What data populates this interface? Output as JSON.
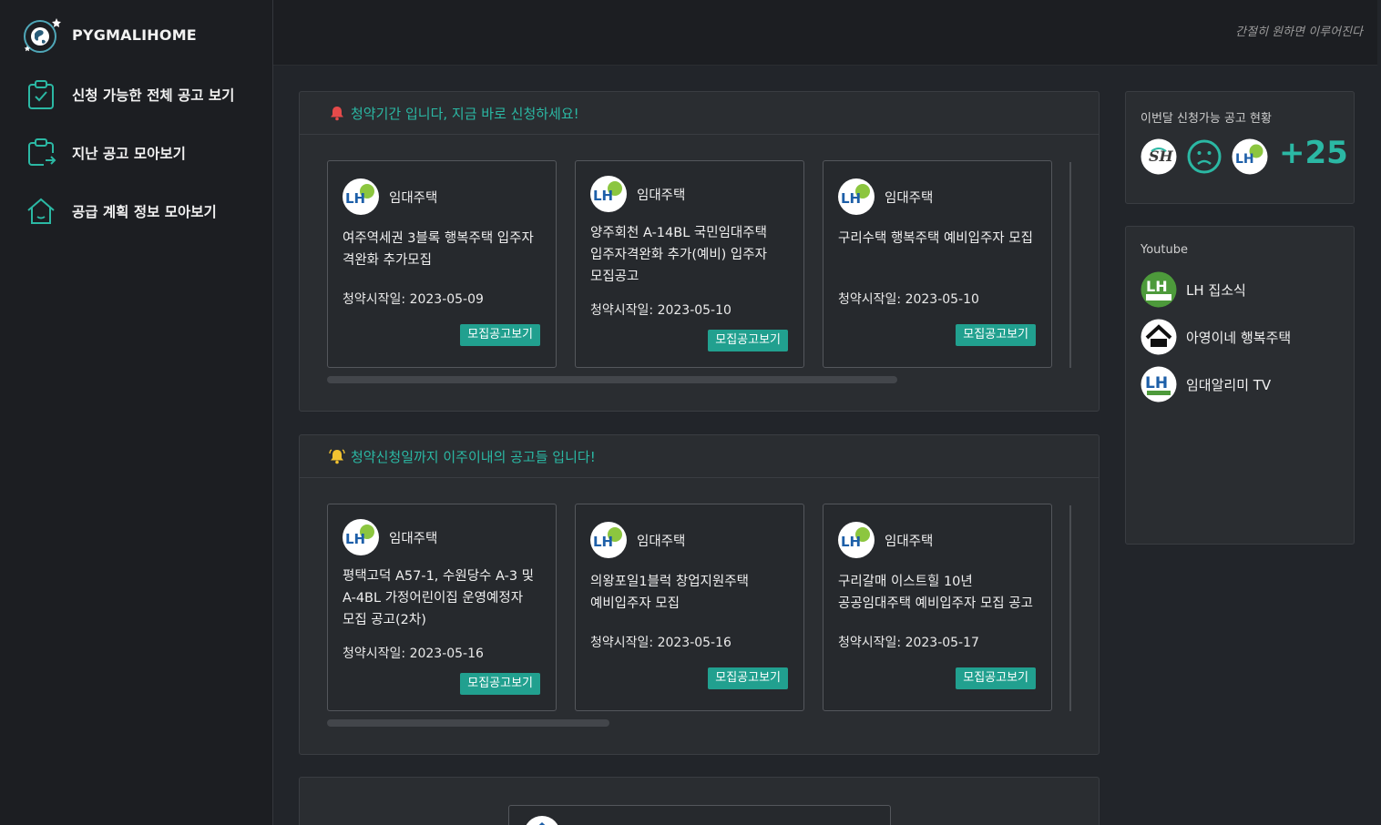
{
  "brand": {
    "name": "PYGMALIHOME",
    "logo_icon": "globe-star-logo"
  },
  "sidebar": {
    "items": [
      {
        "label": "신청 가능한 전체 공고 보기",
        "icon": "clipboard-check-icon"
      },
      {
        "label": "지난 공고 모아보기",
        "icon": "clipboard-share-icon"
      },
      {
        "label": "공급 계획 정보 모아보기",
        "icon": "house-icon"
      }
    ]
  },
  "topbar": {
    "tagline": "간절히 원하면 이루어진다"
  },
  "sections": [
    {
      "heading": "청약기간 입니다, 지금 바로 신청하세요!",
      "icon": "bell-red-icon",
      "cards": [
        {
          "type": "임대주택",
          "title": "여주역세권 3블록 행복주택 입주자 격완화 추가모집",
          "date": "청약시작일: 2023-05-09",
          "button": "모집공고보기"
        },
        {
          "type": "임대주택",
          "title": "양주회천 A-14BL 국민임대주택 입주자격완화 추가(예비) 입주자 모집공고",
          "date": "청약시작일: 2023-05-10",
          "button": "모집공고보기"
        },
        {
          "type": "임대주택",
          "title": "구리수택 행복주택 예비입주자 모집",
          "date": "청약시작일: 2023-05-10",
          "button": "모집공고보기"
        }
      ]
    },
    {
      "heading": "청약신청일까지 이주이내의 공고들 입니다!",
      "icon": "bell-yellow-icon",
      "cards": [
        {
          "type": "임대주택",
          "title": "평택고덕 A57-1, 수원당수 A-3 및 A-4BL 가정어린이집 운영예정자 모집 공고(2차)",
          "date": "청약시작일: 2023-05-16",
          "button": "모집공고보기"
        },
        {
          "type": "임대주택",
          "title": "의왕포일1블럭 창업지원주택 예비입주자 모집",
          "date": "청약시작일: 2023-05-16",
          "button": "모집공고보기"
        },
        {
          "type": "임대주택",
          "title": "구리갈매 이스트힐 10년 공공임대주택 예비입주자 모집 공고",
          "date": "청약시작일: 2023-05-17",
          "button": "모집공고보기"
        }
      ]
    }
  ],
  "monthly": {
    "title": "이번달 신청가능 공고 현황",
    "providers": [
      "sh-logo",
      "sad-face-icon",
      "lh-logo"
    ],
    "count": "+25"
  },
  "youtube": {
    "title": "Youtube",
    "channels": [
      {
        "name": "LH 집소식",
        "icon": "lh-zipsosik-logo"
      },
      {
        "name": "아영이네 행복주택",
        "icon": "ayoung-house-logo"
      },
      {
        "name": "임대알리미 TV",
        "icon": "lh-imdae-alimi-logo"
      }
    ]
  },
  "colors": {
    "accent": "#2bb8a4",
    "button": "#21a08f",
    "background": "#22252a",
    "sidebar": "#1c1e22"
  }
}
